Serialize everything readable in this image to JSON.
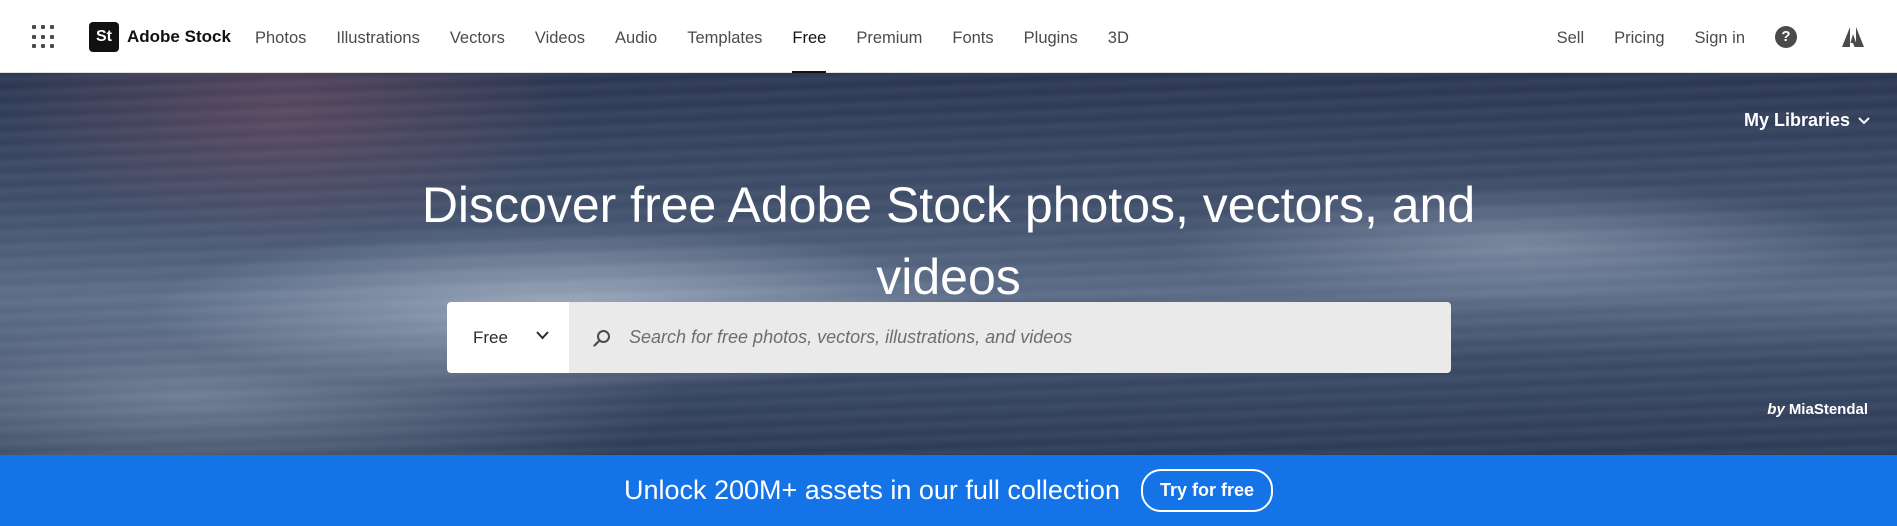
{
  "nav": {
    "brand_mark": "St",
    "brand_name": "Adobe Stock",
    "links": [
      "Photos",
      "Illustrations",
      "Vectors",
      "Videos",
      "Audio",
      "Templates",
      "Free",
      "Premium",
      "Fonts",
      "Plugins",
      "3D"
    ],
    "active_link": "Free",
    "right": {
      "sell": "Sell",
      "pricing": "Pricing",
      "sign_in": "Sign in"
    },
    "help_icon_glyph": "?"
  },
  "hero": {
    "my_libraries": "My Libraries",
    "title_line1": "Discover free Adobe Stock photos, vectors, and",
    "title_line2": "videos",
    "search": {
      "scope": "Free",
      "placeholder": "Search for free photos, vectors, illustrations, and videos",
      "value": ""
    },
    "credit_by": "by",
    "credit_author": "MiaStendal"
  },
  "promo": {
    "text": "Unlock 200M+ assets in our full collection",
    "button": "Try for free"
  },
  "colors": {
    "promo_background": "#1473e6",
    "nav_text": "#4b4b4b",
    "active_underline": "#111111"
  },
  "icons": [
    "app-switcher-icon",
    "adobe-stock-logo",
    "help-icon",
    "adobe-logo-icon",
    "chevron-down-icon",
    "search-icon"
  ]
}
